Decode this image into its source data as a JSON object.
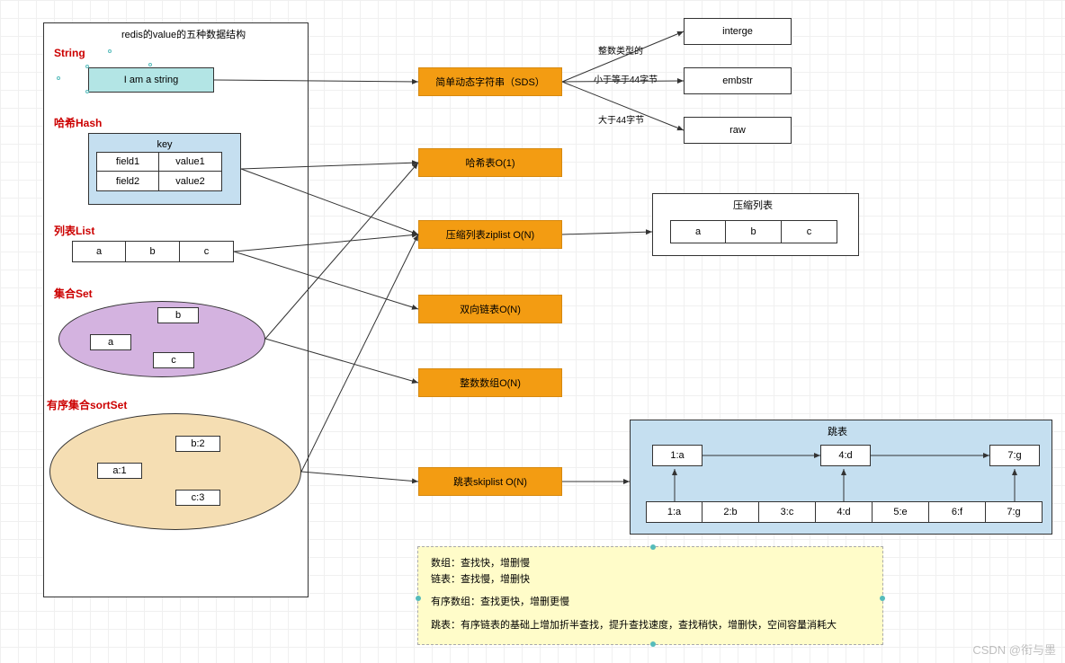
{
  "title": "redis的value的五种数据结构",
  "sections": {
    "string": "String",
    "hash": "哈希Hash",
    "list": "列表List",
    "set": "集合Set",
    "sortset": "有序集合sortSet"
  },
  "string_example": "I am a string",
  "hash_table": {
    "header": "key",
    "rows": [
      {
        "field": "field1",
        "value": "value1"
      },
      {
        "field": "field2",
        "value": "value2"
      }
    ]
  },
  "list_items": [
    "a",
    "b",
    "c"
  ],
  "set_items": [
    "a",
    "b",
    "c"
  ],
  "sortset_items": [
    "a:1",
    "b:2",
    "c:3"
  ],
  "impl_boxes": {
    "sds": "简单动态字符串（SDS）",
    "hashO1": "哈希表O(1)",
    "ziplist": "压缩列表ziplist O(N)",
    "linked": "双向链表O(N)",
    "intset": "整数数组O(N)",
    "skiplist": "跳表skiplist O(N)"
  },
  "sds_branches": {
    "a_label": "整数类型的",
    "a_target": "interge",
    "b_label": "小于等于44字节",
    "b_target": "embstr",
    "c_label": "大于44字节",
    "c_target": "raw"
  },
  "ziplist_box": {
    "title": "压缩列表",
    "cells": [
      "a",
      "b",
      "c"
    ]
  },
  "skiplist_box": {
    "title": "跳表",
    "top": [
      "1:a",
      "4:d",
      "7:g"
    ],
    "bottom": [
      "1:a",
      "2:b",
      "3:c",
      "4:d",
      "5:e",
      "6:f",
      "7:g"
    ]
  },
  "note": {
    "line1": "数组：查找快，增删慢",
    "line2": "链表：查找慢，增删快",
    "line3": "有序数组：查找更快，增删更慢",
    "line4": "跳表：有序链表的基础上增加折半查找，提升查找速度，查找稍快，增删快，空间容量消耗大"
  },
  "watermark": "CSDN @衔与墨"
}
